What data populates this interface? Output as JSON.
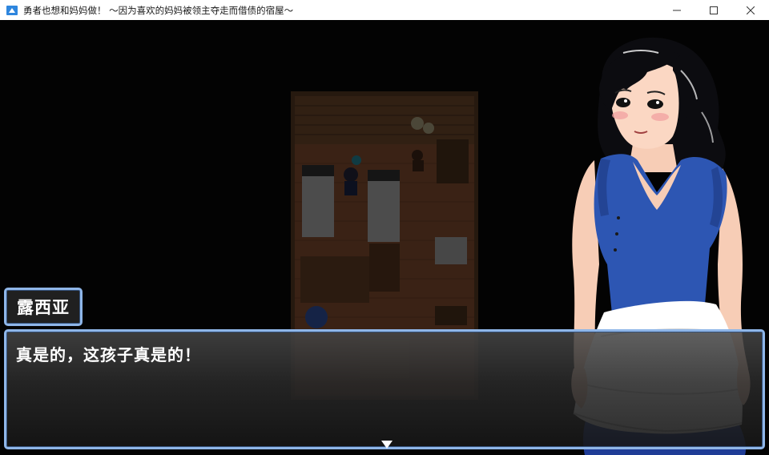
{
  "window": {
    "title": "勇者也想和妈妈做！ ～因为喜欢的妈妈被领主夺走而借债的宿屋～",
    "controls": [
      "minimize-icon",
      "maximize-icon",
      "close-icon"
    ]
  },
  "dialog": {
    "speaker": "露西亚",
    "message": "真是的，这孩子真是的！",
    "continue_icon": "down-triangle-icon"
  },
  "colors": {
    "window_frame": "#8fb6e8",
    "dialog_bg": "#2a2a2a",
    "dialog_text": "#ffffff",
    "shirt": "#2d56b3"
  }
}
